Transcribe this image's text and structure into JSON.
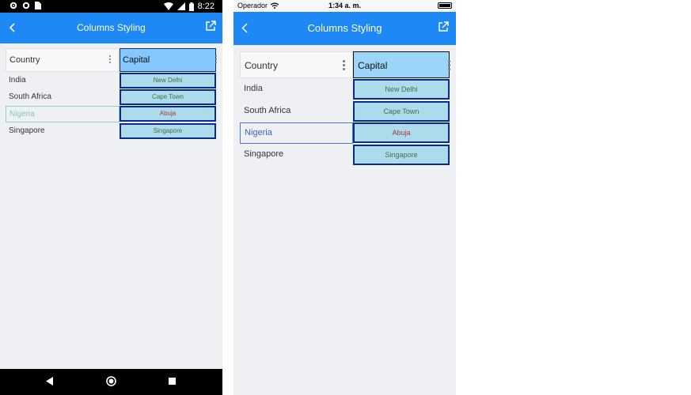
{
  "android": {
    "status": {
      "time": "8:22"
    },
    "toolbar": {
      "title": "Columns Styling"
    },
    "grid": {
      "columns": [
        "Country",
        "Capital"
      ],
      "rows": [
        {
          "country": "India",
          "capital": "New Delhi"
        },
        {
          "country": "South Africa",
          "capital": "Cape Town"
        },
        {
          "country": "Nigeria",
          "capital": "Abuja"
        },
        {
          "country": "Singapore",
          "capital": "Singapore"
        }
      ]
    }
  },
  "ios": {
    "status": {
      "carrier": "Operador",
      "time": "1:34 a. m."
    },
    "toolbar": {
      "title": "Columns Styling"
    },
    "grid": {
      "columns": [
        "Country",
        "Capital"
      ],
      "rows": [
        {
          "country": "India",
          "capital": "New Delhi"
        },
        {
          "country": "South Africa",
          "capital": "Cape Town"
        },
        {
          "country": "Nigeria",
          "capital": "Abuja"
        },
        {
          "country": "Singapore",
          "capital": "Singapore"
        }
      ]
    }
  },
  "colors": {
    "toolbar": "#1e88f5",
    "capital_header_bg": "#85c8ff",
    "capital_cell_bg": "#acdcec",
    "capital_cell_border": "#0c2a88",
    "capital_text_green": "#426f45",
    "capital_text_red": "#a63a3a"
  },
  "icons": [
    "settings-icon",
    "circle-icon",
    "sim-icon",
    "wifi-icon",
    "signal-icon",
    "battery-icon",
    "back-icon",
    "external-link-icon",
    "nav-back-icon",
    "nav-home-icon",
    "nav-recents-icon"
  ]
}
